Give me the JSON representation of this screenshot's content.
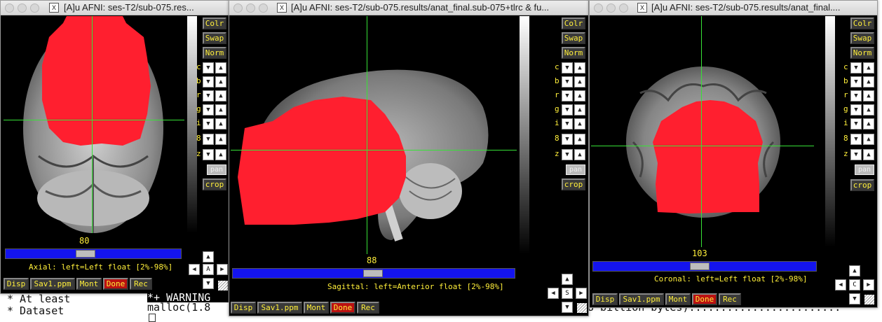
{
  "terminal": {
    "line1": "* At least",
    "line2": "* Dataset",
    "line3": "*+ WARNING",
    "line4": "malloc(1.8",
    "line5": "8 billion bytes)........................"
  },
  "colors": {
    "overlay": "#ff1f2f",
    "crosshair": "#36e236",
    "button_text": "#ffef3a",
    "slider": "#1414ee",
    "done": "#b11111"
  },
  "windows": [
    {
      "title": "[A]u AFNI: ses-T2/sub-075.res...",
      "slice": "80",
      "status": "Axial: left=Left float [2%-98%]",
      "nav_label": "A"
    },
    {
      "title": "[A]u AFNI: ses-T2/sub-075.results/anat_final.sub-075+tlrc & fu...",
      "slice": "88",
      "status": "Sagittal: left=Anterior float [2%-98%]",
      "nav_label": "S"
    },
    {
      "title": "[A]u AFNI: ses-T2/sub-075.results/anat_final....",
      "slice": "103",
      "status": "Coronal: left=Left float [2%-98%]",
      "nav_label": "C"
    }
  ],
  "side_buttons": {
    "colr": "Colr",
    "swap": "Swap",
    "norm": "Norm",
    "pan": "pan",
    "crop": "crop"
  },
  "side_rows": [
    "c",
    "b",
    "r",
    "g",
    "i",
    "8",
    "z"
  ],
  "bottom_buttons": {
    "disp": "Disp",
    "save": "Sav1.ppm",
    "mont": "Mont",
    "done": "Done",
    "rec": "Rec"
  },
  "icons": {
    "close": "X",
    "down": "▼",
    "up": "▲",
    "left": "◀",
    "right": "▶"
  }
}
